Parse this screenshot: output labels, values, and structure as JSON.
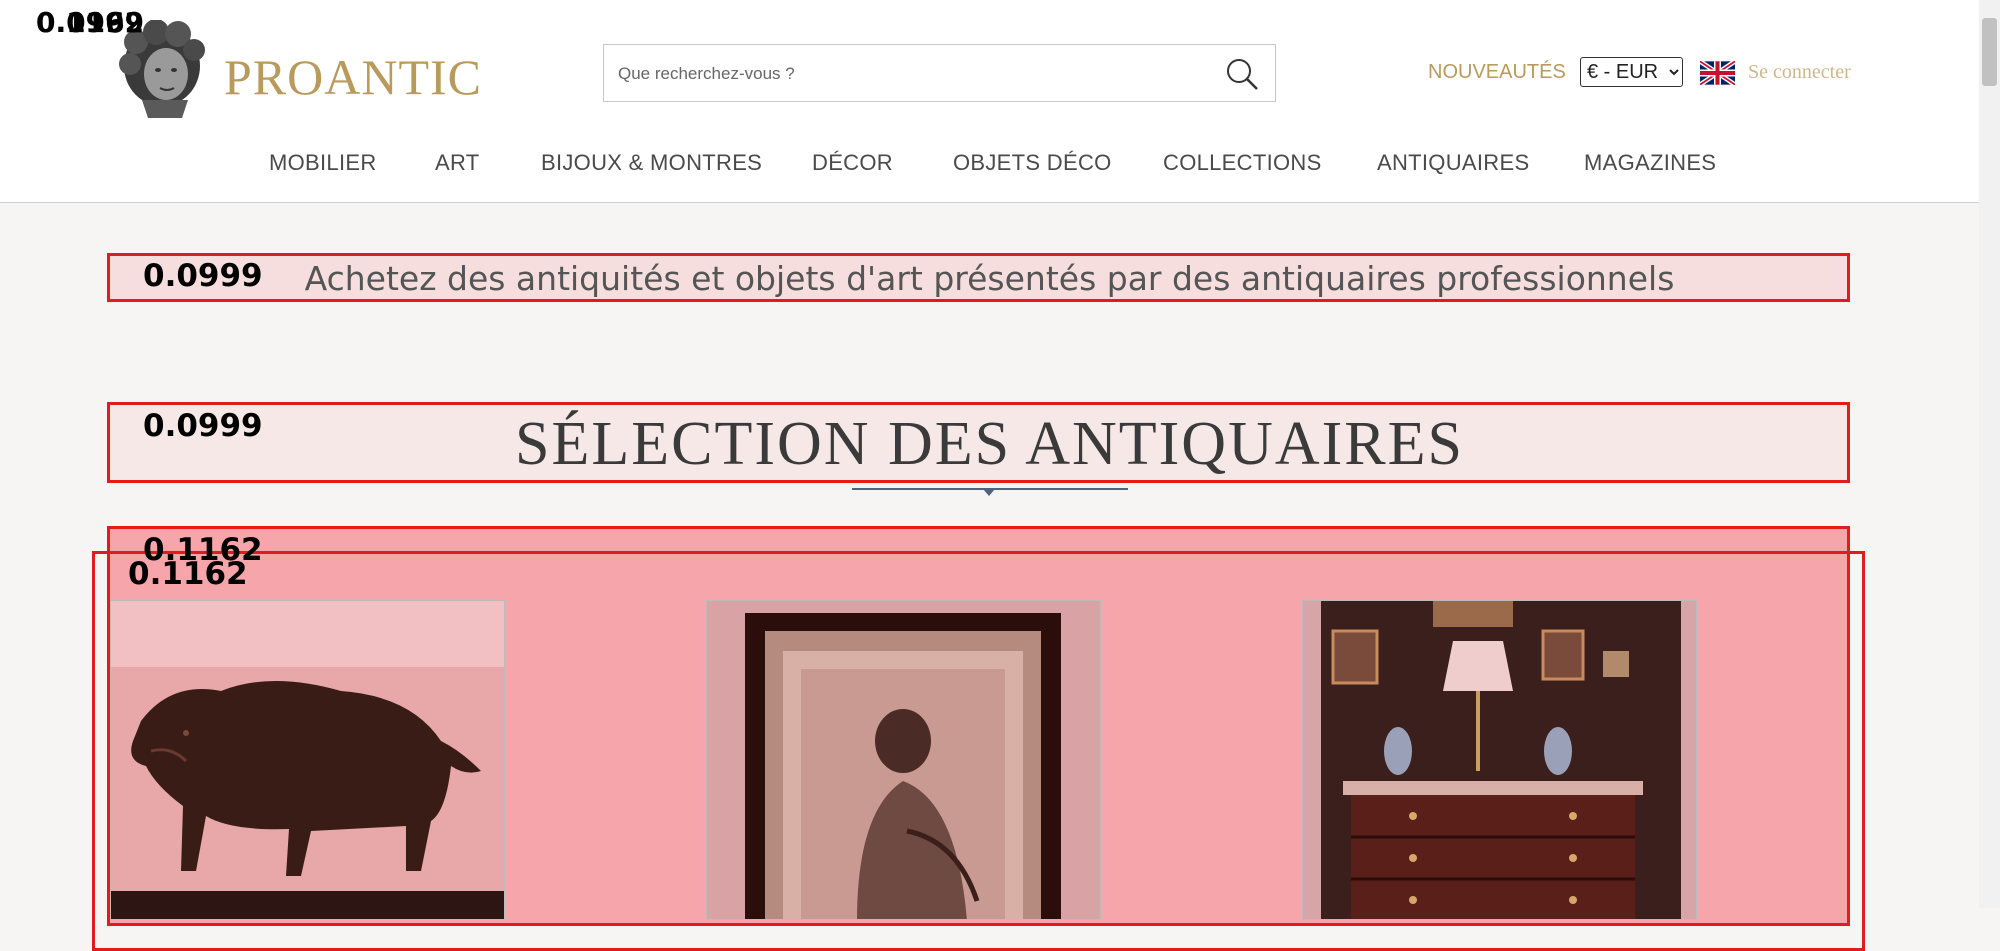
{
  "header": {
    "brand": "PROANTIC",
    "search_placeholder": "Que recherchez-vous ?",
    "new_link": "NOUVEAUTÉS",
    "currency_selected": "€ - EUR",
    "login": "Se connecter",
    "flag_icon": "uk-flag-icon",
    "search_icon": "search-icon",
    "logo_icon": "bust-logo-icon"
  },
  "nav": [
    "MOBILIER",
    "ART",
    "BIJOUX & MONTRES",
    "DÉCOR",
    "OBJETS DÉCO",
    "COLLECTIONS",
    "ANTIQUAIRES",
    "MAGAZINES"
  ],
  "tagline": "Achetez des antiquités et objets d'art présentés par des antiquaires professionnels",
  "section_title": "SÉLECTION DES ANTIQUAIRES",
  "scores": {
    "corner_a": "0.1162",
    "corner_b": "0.0999",
    "tagline": "0.0999",
    "title": "0.0999",
    "grid_a": "0.1162",
    "grid_b": "0.1162"
  },
  "products": [
    {
      "image": "bronze-boar-sculpture"
    },
    {
      "image": "framed-portrait-drawing"
    },
    {
      "image": "antique-chest-of-drawers"
    }
  ],
  "colors": {
    "accent_gold": "#b99a5b",
    "overlay_red": "#e11c1c"
  }
}
